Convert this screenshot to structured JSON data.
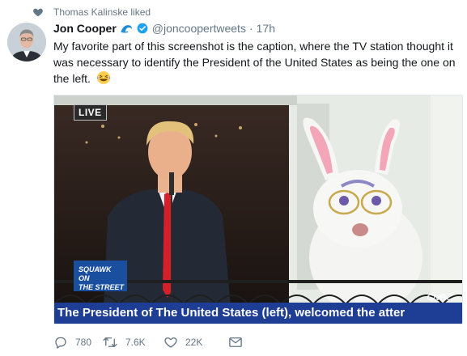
{
  "social_context": {
    "text": "Thomas Kalinske liked"
  },
  "tweet": {
    "author_name": "Jon Cooper",
    "handle": "@joncoopertweets",
    "separator": "·",
    "time": "17h",
    "text": "My favorite part of this screenshot is the caption, where the TV station thought it was necessary to identify the President of the United States as being the one on the left.",
    "media": {
      "live_badge": "LIVE",
      "show_line1": "SQUAWK ON",
      "show_line2": "THE STREET",
      "caption": "The President of The United States (left), welcomed the atter",
      "network": "CNBC"
    },
    "actions": {
      "replies": "780",
      "retweets": "7.6K",
      "likes": "22K"
    }
  },
  "colors": {
    "secondary_text": "#657786",
    "verified_blue": "#1da1f2",
    "caption_bar": "#1e3d94"
  },
  "icons": [
    "heart-icon",
    "wave-icon",
    "verified-badge-icon",
    "laughing-emoji-icon",
    "reply-icon",
    "retweet-icon",
    "like-icon",
    "direct-message-icon"
  ]
}
